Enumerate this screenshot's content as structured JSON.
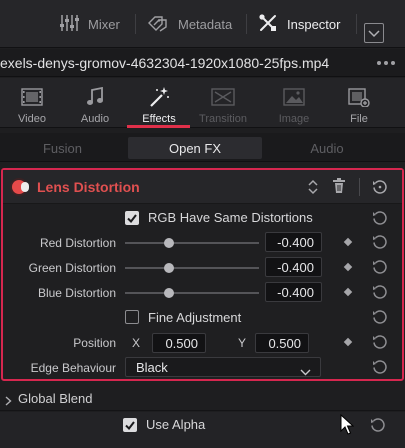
{
  "topbar": {
    "mixer_label": "Mixer",
    "metadata_label": "Metadata",
    "inspector_label": "Inspector",
    "icons": [
      "mixer-icon",
      "metadata-icon",
      "inspector-icon",
      "chevron-down-icon"
    ]
  },
  "file": {
    "name": "exels-denys-gromov-4632304-1920x1080-25fps.mp4",
    "more_icon": "more-icon"
  },
  "tabs": [
    {
      "label": "Video",
      "icon": "video-icon",
      "state": "normal"
    },
    {
      "label": "Audio",
      "icon": "audio-icon",
      "state": "normal"
    },
    {
      "label": "Effects",
      "icon": "effects-icon",
      "state": "active"
    },
    {
      "label": "Transition",
      "icon": "transition-icon",
      "state": "disabled"
    },
    {
      "label": "Image",
      "icon": "image-icon",
      "state": "disabled"
    },
    {
      "label": "File",
      "icon": "file-icon",
      "state": "normal"
    }
  ],
  "subtabs": [
    {
      "label": "Fusion",
      "active": false
    },
    {
      "label": "Open FX",
      "active": true
    },
    {
      "label": "Audio",
      "active": false
    }
  ],
  "effect": {
    "title": "Lens Distortion",
    "enabled": true,
    "rgb_same": {
      "label": "RGB Have Same Distortions",
      "checked": true
    },
    "rows": [
      {
        "label": "Red Distortion",
        "value": "-0.400"
      },
      {
        "label": "Green Distortion",
        "value": "-0.400"
      },
      {
        "label": "Blue Distortion",
        "value": "-0.400"
      }
    ],
    "fine": {
      "label": "Fine Adjustment",
      "checked": false
    },
    "position": {
      "label": "Position",
      "x_label": "X",
      "x_value": "0.500",
      "y_label": "Y",
      "y_value": "0.500"
    },
    "edge": {
      "label": "Edge Behaviour",
      "value": "Black"
    }
  },
  "global_blend": {
    "label": "Global Blend"
  },
  "use_alpha": {
    "label": "Use Alpha",
    "checked": true
  },
  "colors": {
    "accent": "#e0304a",
    "panel_border": "#d6274f",
    "title": "#e05050"
  }
}
